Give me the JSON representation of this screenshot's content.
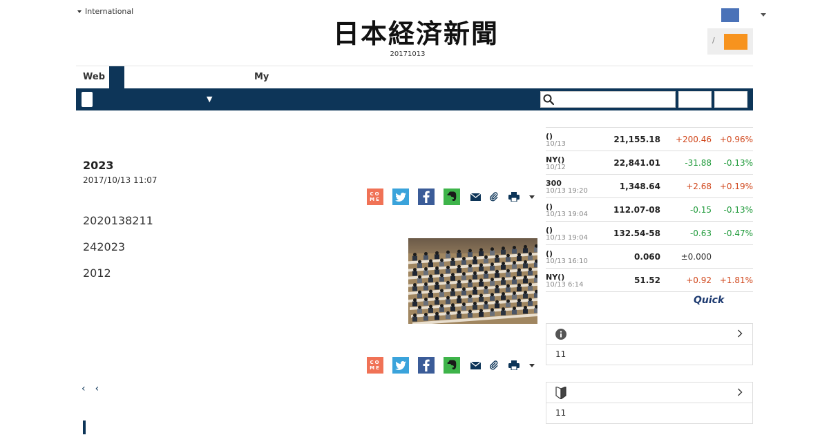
{
  "header": {
    "edition_label": "International",
    "masthead": "日本経済新聞",
    "issue_date": "20171013",
    "login_separator": "/"
  },
  "tabs": {
    "web": "Web",
    "my": "My"
  },
  "navbar": {
    "dropdown_arrow": "▼",
    "search_placeholder": ""
  },
  "article": {
    "headline": "2023",
    "published": "2017/10/13 11:07",
    "paragraphs": [
      "2020138211",
      "242023",
      "2012"
    ],
    "share": {
      "comment_label_top": "CO",
      "comment_label_bottom": "ME"
    },
    "prev_links": [
      "‹",
      "‹"
    ]
  },
  "market": {
    "rows": [
      {
        "name": "()",
        "date": "10/13",
        "value": "21,155.18",
        "change": "+200.46",
        "pct": "+0.96%",
        "dir": "up"
      },
      {
        "name": "NY()",
        "date": "10/12",
        "value": "22,841.01",
        "change": "-31.88",
        "pct": "-0.13%",
        "dir": "dn"
      },
      {
        "name": "300",
        "date": "10/13 19:20",
        "value": "1,348.64",
        "change": "+2.68",
        "pct": "+0.19%",
        "dir": "up"
      },
      {
        "name": "()",
        "date": "10/13 19:04",
        "value": "112.07-08",
        "change": "-0.15",
        "pct": "-0.13%",
        "dir": "dn"
      },
      {
        "name": "()",
        "date": "10/13 19:04",
        "value": "132.54-58",
        "change": "-0.63",
        "pct": "-0.47%",
        "dir": "dn"
      },
      {
        "name": "()",
        "date": "10/13 16:10",
        "value": "0.060",
        "change": "±0.000",
        "pct": "",
        "dir": "flat"
      },
      {
        "name": "NY()",
        "date": "10/13 6:14",
        "value": "51.52",
        "change": "+0.92",
        "pct": "+1.81%",
        "dir": "up"
      }
    ],
    "provider": "Quick"
  },
  "sidebar_boxes": [
    {
      "icon": "info-icon",
      "text": "11"
    },
    {
      "icon": "beginner-mark-icon",
      "text": "11"
    }
  ],
  "colors": {
    "navy": "#0d3558",
    "orange": "#f7931e",
    "up": "#d0461b",
    "down": "#1f9a3a"
  }
}
